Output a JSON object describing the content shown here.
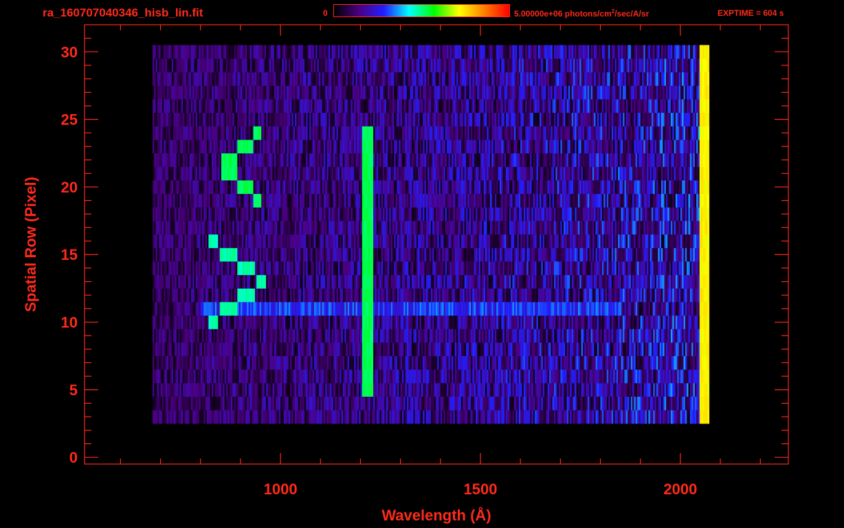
{
  "header": {
    "filename": "ra_160707040346_hisb_lin.fit",
    "colorbar_min": "0",
    "colorbar_max_prefix": "5.00000e+06 photons/cm",
    "colorbar_max_sup": "2",
    "colorbar_max_suffix": "/sec/A/sr",
    "exptime": "EXPTIME = 604 s"
  },
  "colors": {
    "axis": "#ff2a1a",
    "background": "#000000",
    "colormap": [
      "#000000",
      "#4b0082",
      "#2020ff",
      "#00ffff",
      "#00ff00",
      "#ffff00",
      "#ff7f00",
      "#ff0000"
    ]
  },
  "chart_data": {
    "type": "heatmap",
    "title": "ra_160707040346_hisb_lin.fit",
    "xlabel": "Wavelength (Å)",
    "ylabel": "Spatial Row (Pixel)",
    "xlim": [
      510,
      2270
    ],
    "ylim": [
      -0.5,
      32
    ],
    "x_ticks": [
      1000,
      1500,
      2000
    ],
    "y_ticks": [
      0,
      5,
      10,
      15,
      20,
      25,
      30
    ],
    "colorbar_range": [
      0,
      5000000
    ],
    "colorbar_units": "photons/cm^2/sec/A/sr",
    "exptime_s": 604,
    "data_extent": {
      "x_min": 680,
      "x_max": 2070,
      "row_min": 3,
      "row_max": 30
    },
    "features": [
      {
        "name": "Lyman-alpha line",
        "wavelength": 1216,
        "row_range": [
          5,
          24
        ],
        "level": 0.5
      },
      {
        "name": "band row 11",
        "row": 11,
        "wavelength_range": [
          800,
          1850
        ],
        "level": 0.3
      },
      {
        "name": "arc upper",
        "wavelength_range": [
          850,
          950
        ],
        "row_range": [
          19,
          24
        ],
        "level": 0.5
      },
      {
        "name": "arc lower",
        "wavelength_range": [
          820,
          960
        ],
        "row_range": [
          10,
          16
        ],
        "level": 0.45
      },
      {
        "name": "edge line",
        "wavelength": 2060,
        "row_range": [
          1,
          30
        ],
        "level": 0.7
      }
    ]
  }
}
